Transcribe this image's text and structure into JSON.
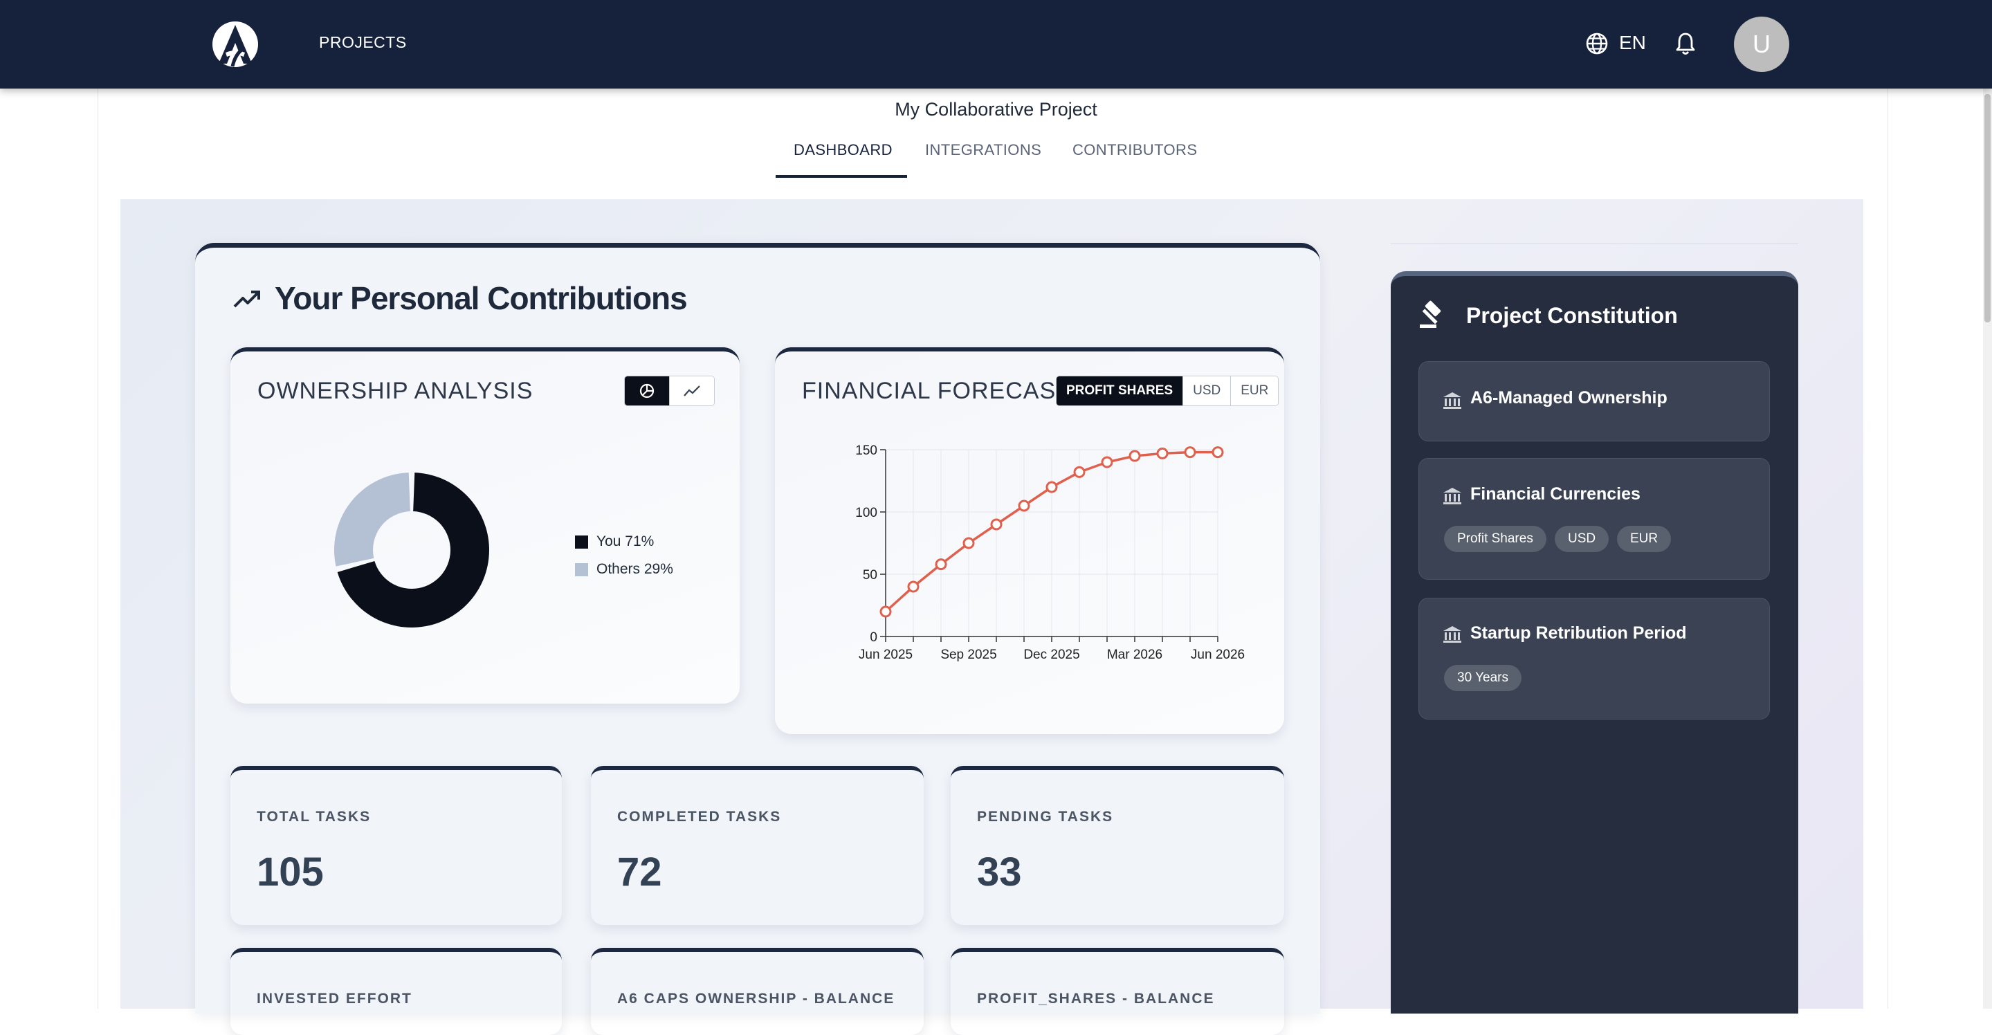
{
  "header": {
    "nav_projects": "PROJECTS",
    "language": "EN",
    "avatar_initial": "U"
  },
  "project": {
    "title": "My Collaborative Project",
    "tabs": [
      {
        "label": "DASHBOARD",
        "active": true
      },
      {
        "label": "INTEGRATIONS",
        "active": false
      },
      {
        "label": "CONTRIBUTORS",
        "active": false
      }
    ]
  },
  "contributions": {
    "title": "Your Personal Contributions",
    "icon": "trending-up-icon"
  },
  "ownership": {
    "title": "OWNERSHIP ANALYSIS",
    "view_toggles": [
      "pie-chart-icon",
      "line-chart-icon"
    ],
    "legend": [
      {
        "label": "You 71%",
        "color": "#0b0f19"
      },
      {
        "label": "Others 29%",
        "color": "#b4c0d3"
      }
    ]
  },
  "forecast": {
    "title": "FINANCIAL FORECAST",
    "currency_toggles": [
      {
        "label": "PROFIT SHARES",
        "active": true
      },
      {
        "label": "USD",
        "active": false
      },
      {
        "label": "EUR",
        "active": false
      }
    ]
  },
  "chart_data": [
    {
      "type": "pie",
      "categories": [
        "You",
        "Others"
      ],
      "values": [
        71,
        29
      ],
      "colors": [
        "#0b0f19",
        "#b4c0d3"
      ],
      "legend_position": "right"
    },
    {
      "type": "line",
      "x": [
        "Jun 2025",
        "Jul 2025",
        "Aug 2025",
        "Sep 2025",
        "Oct 2025",
        "Nov 2025",
        "Dec 2025",
        "Jan 2026",
        "Feb 2026",
        "Mar 2026",
        "Apr 2026",
        "May 2026",
        "Jun 2026"
      ],
      "x_tick_labels": [
        "Jun 2025",
        "Sep 2025",
        "Dec 2025",
        "Mar 2026",
        "Jun 2026"
      ],
      "series": [
        {
          "values": [
            20,
            40,
            58,
            75,
            90,
            105,
            120,
            132,
            140,
            145,
            147,
            148,
            148
          ],
          "color": "#e0604e"
        }
      ],
      "ylim": [
        0,
        150
      ],
      "y_ticks": [
        0,
        50,
        100,
        150
      ],
      "grid": true
    }
  ],
  "stats": [
    {
      "label": "TOTAL TASKS",
      "value": "105",
      "bg": "#e6e9f0"
    },
    {
      "label": "COMPLETED TASKS",
      "value": "72",
      "bg": "#d2f2d9"
    },
    {
      "label": "PENDING TASKS",
      "value": "33",
      "bg": "#fbf3cf"
    },
    {
      "label": "INVESTED EFFORT",
      "value": "",
      "bg": "#f8dada"
    },
    {
      "label": "A6 CAPS OWNERSHIP - BALANCE",
      "value": "",
      "bg": "#d6e3fa"
    },
    {
      "label": "PROFIT_SHARES - BALANCE",
      "value": "",
      "bg": "#d6e3fa"
    }
  ],
  "constitution": {
    "title": "Project Constitution",
    "icon": "gavel-icon",
    "items": [
      {
        "label": "A6-Managed Ownership",
        "icon": "bank-icon",
        "chips": []
      },
      {
        "label": "Financial Currencies",
        "icon": "bank-icon",
        "chips": [
          "Profit Shares",
          "USD",
          "EUR"
        ]
      },
      {
        "label": "Startup Retribution Period",
        "icon": "bank-icon",
        "chips": [
          "30 Years"
        ]
      }
    ]
  }
}
